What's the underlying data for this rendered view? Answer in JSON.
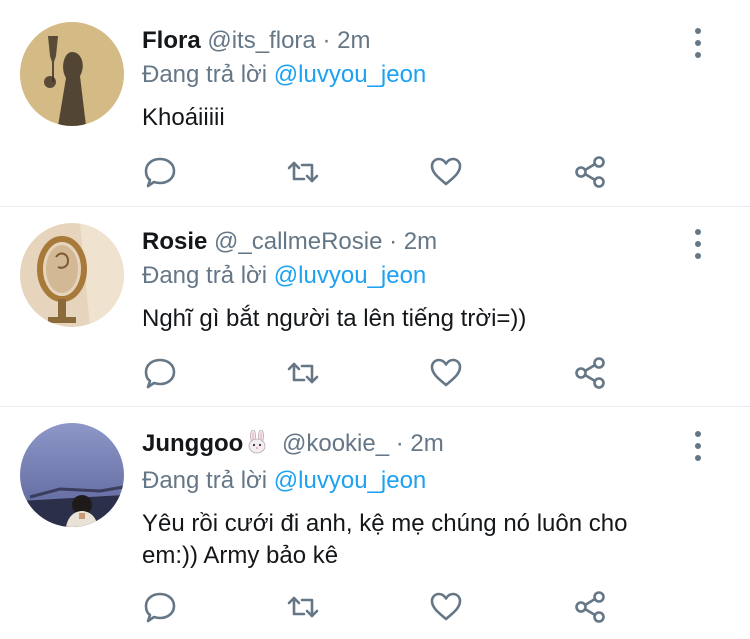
{
  "tweets": [
    {
      "name": "Flora",
      "handle": "@its_flora",
      "separator": "·",
      "time": "2m",
      "reply_prefix": "Đang trả lời",
      "reply_to": "@luvyou_jeon",
      "text": "Khoáiiiii"
    },
    {
      "name": "Rosie",
      "handle": "@_callmeRosie",
      "separator": "·",
      "time": "2m",
      "reply_prefix": "Đang trả lời",
      "reply_to": "@luvyou_jeon",
      "text": "Nghĩ gì bắt người ta lên tiếng trời=))"
    },
    {
      "name": "Junggoo",
      "name_emoji": "rabbit-face-emoji",
      "handle": "@kookie_",
      "separator": "·",
      "time": "2m",
      "reply_prefix": "Đang trả lời",
      "reply_to": "@luvyou_jeon",
      "text": "Yêu rồi cưới đi anh, kệ mẹ chúng nó luôn cho em:)) Army bảo kê"
    }
  ],
  "icons": {
    "reply": "comment-bubble-icon",
    "retweet": "retweet-icon",
    "like": "heart-icon",
    "share": "share-icon",
    "more": "more-vertical-icon"
  },
  "colors": {
    "text": "#14171a",
    "secondary": "#657786",
    "mention": "#1da1f2",
    "divider": "#e6ecf0"
  }
}
